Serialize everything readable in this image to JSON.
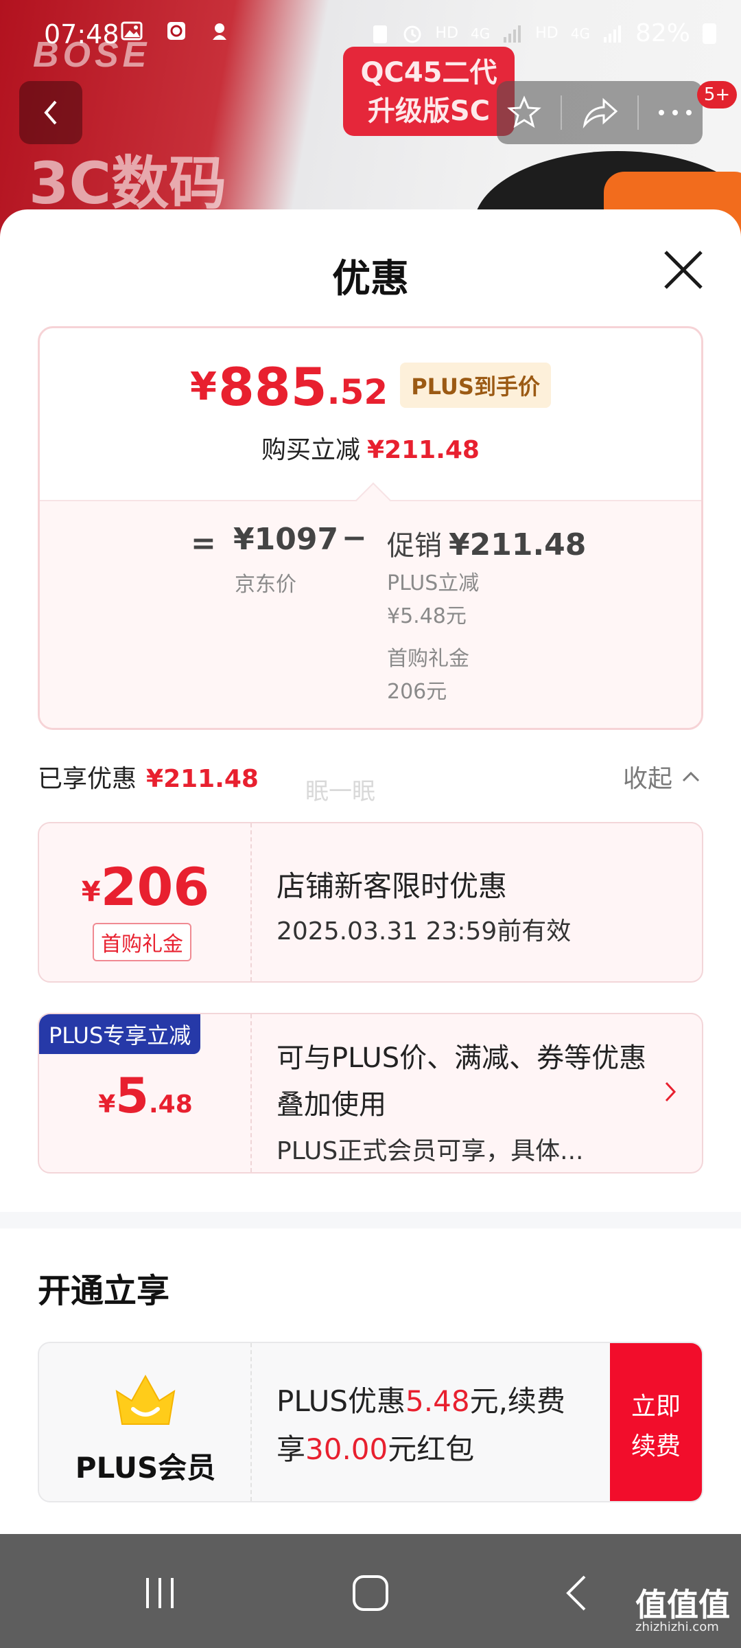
{
  "status_bar": {
    "time": "07:48",
    "network_left": "HD",
    "network_4g_1": "4G",
    "network_right": "HD",
    "network_4g_2": "4G",
    "battery": "82%"
  },
  "background": {
    "brand": "BOSE",
    "category": "3C数码",
    "product_tag_line1": "QC45二代",
    "product_tag_line2": "升级版SC",
    "cart_count": "5+"
  },
  "sheet": {
    "title": "优惠"
  },
  "price_card": {
    "currency": "¥",
    "price_int": "885",
    "price_dec": ".52",
    "plus_tag": "PLUS到手价",
    "buy_reduce_label": "购买立减",
    "buy_reduce_value": "¥211.48",
    "equals": "=",
    "jd_price": "¥1097",
    "jd_price_label": "京东价",
    "minus": "−",
    "promo_label": "促销",
    "promo_value": "¥211.48",
    "plus_reduce_label": "PLUS立减",
    "plus_reduce_value": "¥5.48元",
    "first_gift_label": "首购礼金",
    "first_gift_value": "206元"
  },
  "enjoyed": {
    "label": "已享优惠",
    "value": "¥211.48",
    "collapse_label": "收起"
  },
  "watermark_mid": "眠一眠",
  "coupon_first": {
    "currency": "¥",
    "amount": "206",
    "tag": "首购礼金",
    "title": "店铺新客限时优惠",
    "valid": "2025.03.31 23:59前有效"
  },
  "coupon_plus": {
    "label": "PLUS专享立减",
    "currency": "¥",
    "amount_int": "5",
    "amount_dec": ".48",
    "desc": "可与PLUS价、满减、券等优惠叠加使用",
    "desc2": "PLUS正式会员可享，具体..."
  },
  "open_section": {
    "title": "开通立享"
  },
  "plus_card": {
    "name": "PLUS会员",
    "desc_prefix": "PLUS优惠",
    "desc_value1": "5.48",
    "desc_mid": "元,续费享",
    "desc_value2": "30.00",
    "desc_suffix": "元红包",
    "button_line1": "立即",
    "button_line2": "续费"
  },
  "corner_watermark": {
    "logo": "值值值",
    "domain": "zhizhizhi.com"
  },
  "colors": {
    "accent_red": "#e8202f",
    "button_red": "#f20d2b",
    "plus_blue": "#2639a8",
    "plus_gold": "#9b5a14"
  }
}
